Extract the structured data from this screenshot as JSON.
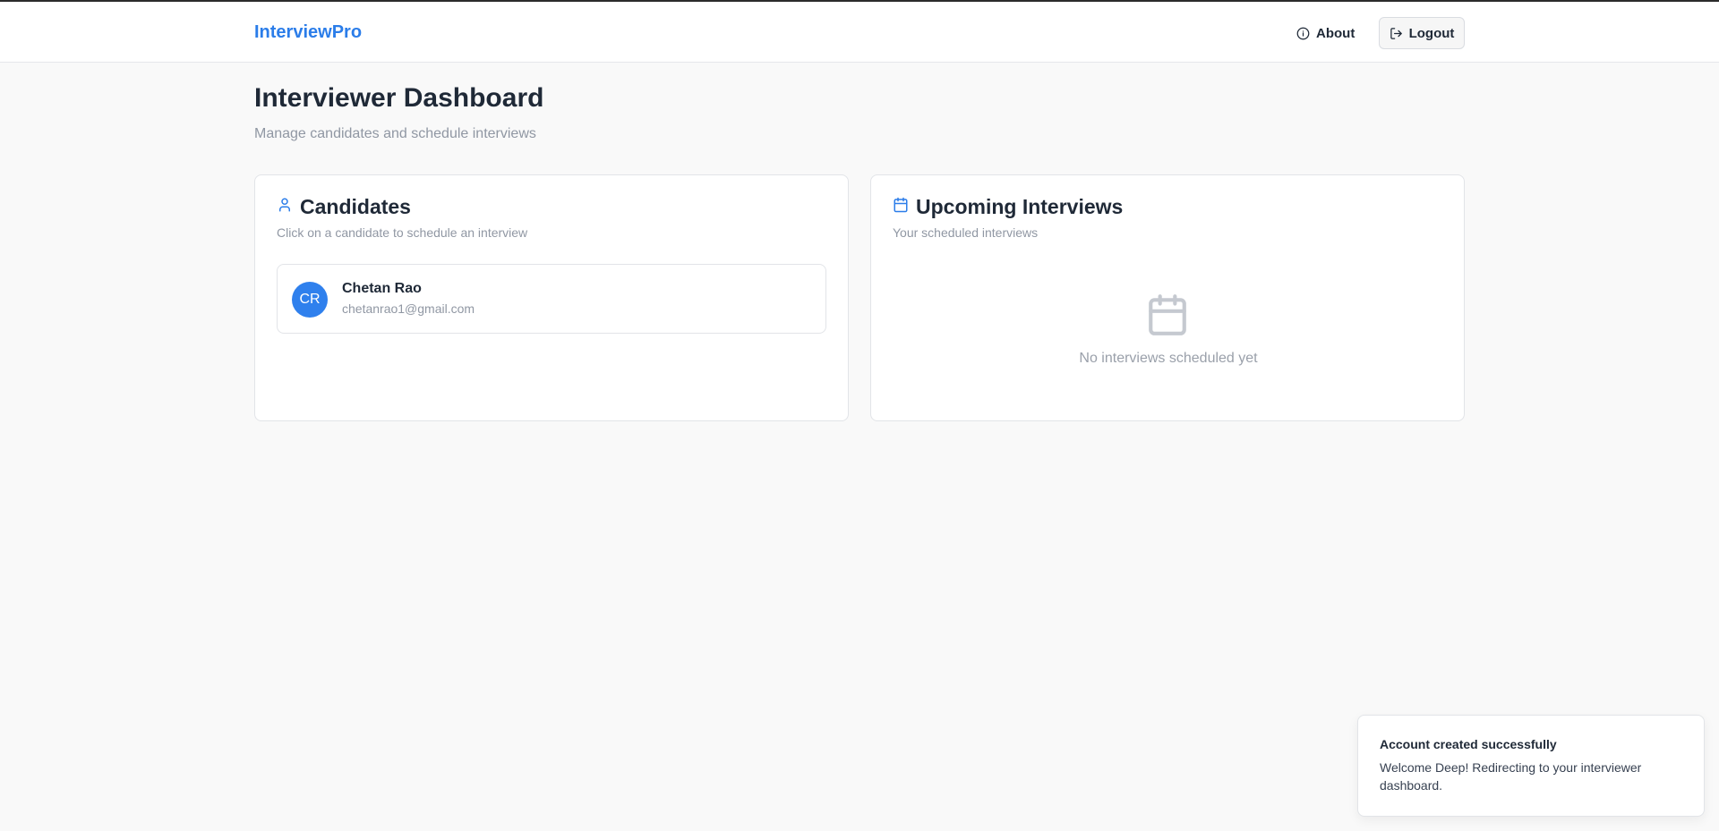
{
  "nav": {
    "brand": "InterviewPro",
    "about_label": "About",
    "logout_label": "Logout"
  },
  "header": {
    "title": "Interviewer Dashboard",
    "subtitle": "Manage candidates and schedule interviews"
  },
  "candidates": {
    "title": "Candidates",
    "subtitle": "Click on a candidate to schedule an interview",
    "items": [
      {
        "initials": "CR",
        "name": "Chetan Rao",
        "email": "chetanrao1@gmail.com"
      }
    ]
  },
  "interviews": {
    "title": "Upcoming Interviews",
    "subtitle": "Your scheduled interviews",
    "empty_text": "No interviews scheduled yet"
  },
  "toast": {
    "title": "Account created successfully",
    "body": "Welcome Deep! Redirecting to your interviewer dashboard."
  },
  "colors": {
    "brand": "#2b7de9",
    "avatar": "#2f80ed",
    "background": "#f9f9f9"
  },
  "icons": {
    "about": "info-circle-icon",
    "logout": "logout-icon",
    "candidates": "user-icon",
    "interviews": "calendar-icon",
    "empty_state": "calendar-icon"
  }
}
